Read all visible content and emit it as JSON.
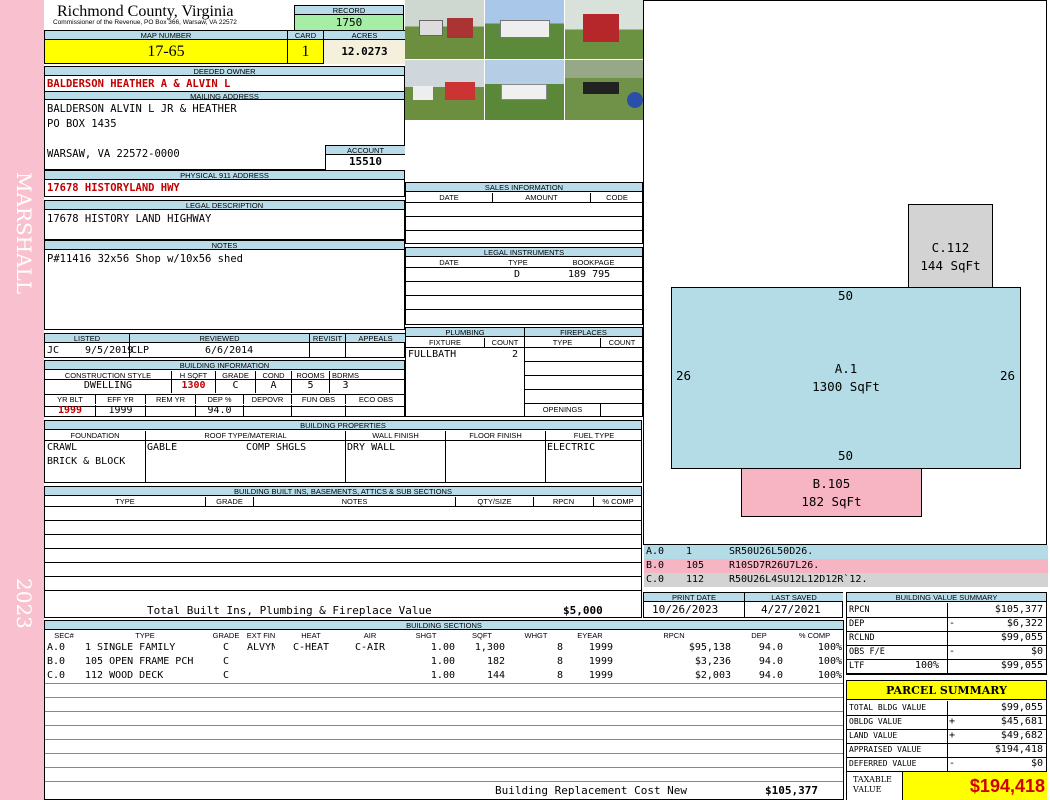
{
  "sidebar": {
    "district": "MARSHALL",
    "year": "2023"
  },
  "header": {
    "county": "Richmond County, Virginia",
    "commissioner": "Commissioner of the Revenue, PO Box 366, Warsaw, VA 22572",
    "record_label": "RECORD",
    "record": "1750",
    "map_label": "MAP NUMBER",
    "map": "17-65",
    "card_label": "CARD",
    "card": "1",
    "acres_label": "ACRES",
    "acres": "12.0273"
  },
  "owner": {
    "label": "DEEDED OWNER",
    "name": "BALDERSON HEATHER A & ALVIN L",
    "mail_label": "MAILING ADDRESS",
    "mail": [
      "BALDERSON ALVIN L JR & HEATHER",
      "PO BOX 1435",
      "",
      "WARSAW, VA 22572-0000"
    ],
    "account_label": "ACCOUNT",
    "account": "15510",
    "physical_label": "PHYSICAL 911 ADDRESS",
    "physical": "17678 HISTORYLAND HWY",
    "legal_label": "LEGAL DESCRIPTION",
    "legal": "17678 HISTORY LAND HIGHWAY",
    "notes_label": "NOTES",
    "notes": "P#11416 32x56 Shop w/10x56 shed"
  },
  "review": {
    "h": [
      "LISTED",
      "REVIEWED",
      "REVISIT",
      "APPEALS"
    ],
    "listed_by": "JC",
    "listed": "9/5/2019",
    "reviewed_by": "CLP",
    "reviewed": "6/6/2014"
  },
  "bldg_info": {
    "label": "BUILDING INFORMATION",
    "h1": [
      "CONSTRUCTION STYLE",
      "H SQFT",
      "GRADE",
      "COND",
      "ROOMS",
      "BDRMS"
    ],
    "r1": [
      "DWELLING",
      "1300",
      "C",
      "A",
      "5",
      "3"
    ],
    "h2": [
      "YR BLT",
      "EFF YR",
      "REM YR",
      "DEP %",
      "DEPOVR",
      "FUN OBS",
      "ECO OBS"
    ],
    "r2": [
      "1999",
      "1999",
      "",
      "94.0",
      "",
      "",
      ""
    ]
  },
  "sales": {
    "label": "SALES INFORMATION",
    "h": [
      "DATE",
      "AMOUNT",
      "CODE"
    ]
  },
  "legal_inst": {
    "label": "LEGAL INSTRUMENTS",
    "h": [
      "DATE",
      "TYPE",
      "BOOKPAGE"
    ],
    "type": "D",
    "bookpage": "189 795"
  },
  "plumbing": {
    "label": "PLUMBING",
    "h": [
      "FIXTURE",
      "COUNT"
    ],
    "fixture": "FULLBATH",
    "count": "2"
  },
  "fireplaces": {
    "label": "FIREPLACES",
    "h": [
      "TYPE",
      "COUNT"
    ],
    "openings": "OPENINGS"
  },
  "props": {
    "label": "BUILDING PROPERTIES",
    "h": [
      "FOUNDATION",
      "ROOF TYPE/MATERIAL",
      "WALL FINISH",
      "FLOOR FINISH",
      "FUEL TYPE"
    ],
    "foundation": [
      "CRAWL",
      "BRICK & BLOCK"
    ],
    "roof_type": "GABLE",
    "roof_mat": "COMP SHGLS",
    "wall": "DRY WALL",
    "fuel": "ELECTRIC"
  },
  "builtins": {
    "label": "BUILDING BUILT INS, BASEMENTS, ATTICS & SUB SECTIONS",
    "h": [
      "TYPE",
      "GRADE",
      "NOTES",
      "QTY/SIZE",
      "RPCN",
      "% COMP"
    ],
    "total_label": "Total Built Ins, Plumbing & Fireplace Value",
    "total": "$5,000"
  },
  "sections": {
    "label": "BUILDING SECTIONS",
    "h": [
      "SEC#",
      "TYPE",
      "GRADE",
      "EXT FIN",
      "HEAT",
      "AIR",
      "SHGT",
      "SQFT",
      "WHGT",
      "EYEAR",
      "RPCN",
      "DEP",
      "% COMP"
    ],
    "rows": [
      [
        "A.0",
        "1 SINGLE FAMILY",
        "C",
        "ALVYN",
        "C-HEAT",
        "C-AIR",
        "1.00",
        "1,300",
        "8",
        "1999",
        "$95,138",
        "94.0",
        "100%"
      ],
      [
        "B.0",
        "105 OPEN FRAME PCH",
        "C",
        "",
        "",
        "",
        "1.00",
        "182",
        "8",
        "1999",
        "$3,236",
        "94.0",
        "100%"
      ],
      [
        "C.0",
        "112 WOOD DECK",
        "C",
        "",
        "",
        "",
        "1.00",
        "144",
        "8",
        "1999",
        "$2,003",
        "94.0",
        "100%"
      ]
    ],
    "replacement_label": "Building Replacement Cost New",
    "replacement": "$105,377"
  },
  "sketch": {
    "a_label": "A.1",
    "a_area": "1300 SqFt",
    "b_label": "B.105",
    "b_area": "182 SqFt",
    "c_label": "C.112",
    "c_area": "144 SqFt",
    "dim_top": "50",
    "dim_bottom": "50",
    "dim_left": "26",
    "dim_right": "26",
    "legend": [
      [
        "A.0",
        "1",
        "SR50U26L50D26."
      ],
      [
        "B.0",
        "105",
        "R10SD7R26U7L26."
      ],
      [
        "C.0",
        "112",
        "R50U26L4SU12L12D12R`12."
      ]
    ],
    "colors": {
      "a": "#b4dce6",
      "b": "#f7b4c2",
      "c": "#d3d3d3"
    }
  },
  "dates": {
    "print_label": "PRINT DATE",
    "print": "10/26/2023",
    "saved_label": "LAST SAVED",
    "saved": "4/27/2021"
  },
  "value_summary": {
    "label": "BUILDING VALUE SUMMARY",
    "rows": [
      [
        "RPCN",
        "",
        "$105,377"
      ],
      [
        "DEP",
        "-",
        "$6,322"
      ],
      [
        "RCLND",
        "",
        "$99,055"
      ],
      [
        "OBS F/E",
        "-",
        "$0"
      ],
      [
        "LTF",
        "100%",
        "$99,055"
      ]
    ]
  },
  "parcel": {
    "label": "PARCEL SUMMARY",
    "rows": [
      [
        "TOTAL BLDG VALUE",
        "",
        "$99,055"
      ],
      [
        "OBLDG VALUE",
        "+",
        "$45,681"
      ],
      [
        "LAND VALUE",
        "+",
        "$49,682"
      ],
      [
        "APPRAISED VALUE",
        "",
        "$194,418"
      ],
      [
        "DEFERRED VALUE",
        "-",
        "$0"
      ]
    ],
    "taxable_label": "TAXABLE VALUE",
    "taxable": "$194,418"
  },
  "photos": [
    "shed-photo",
    "house-photo",
    "barn-photo",
    "garage-photo",
    "house-front-photo",
    "mailbox-photo"
  ]
}
